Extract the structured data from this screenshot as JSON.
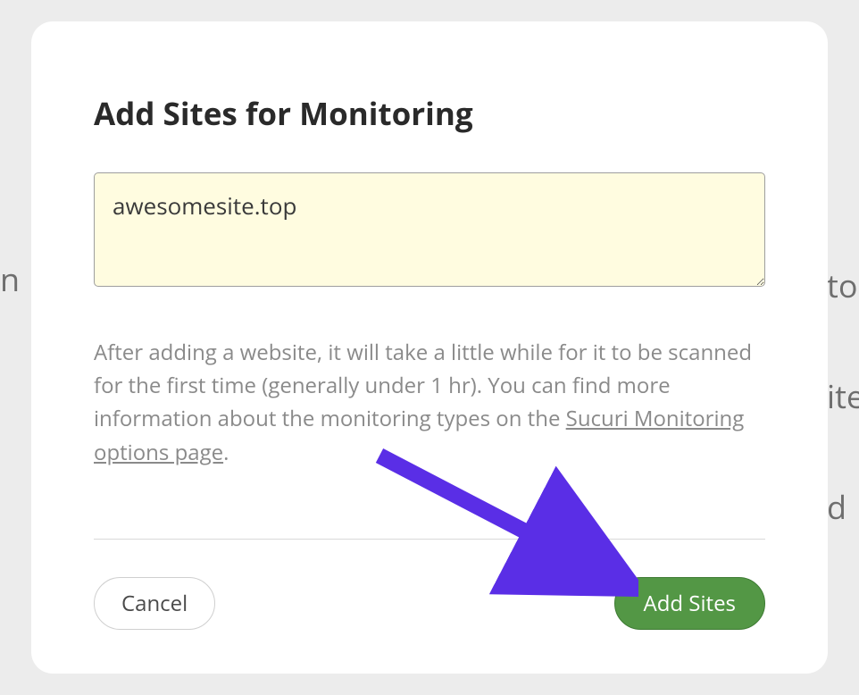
{
  "modal": {
    "title": "Add Sites for Monitoring",
    "input_value": "awesomesite.top",
    "helper_prefix": "After adding a website, it will take a little while for it to be scanned for the first time (generally under 1 hr). You can find more information about the monitoring types on the ",
    "helper_link_text": "Sucuri Monitoring options page",
    "helper_suffix": ".",
    "cancel_label": "Cancel",
    "submit_label": "Add Sites"
  },
  "bg": {
    "left_a": "n",
    "left_b": "",
    "right_a": "to",
    "right_b": "ite",
    "right_c": "d"
  },
  "colors": {
    "arrow": "#5a2ee6",
    "primary_bg": "#539745",
    "input_bg": "#fffce0"
  }
}
